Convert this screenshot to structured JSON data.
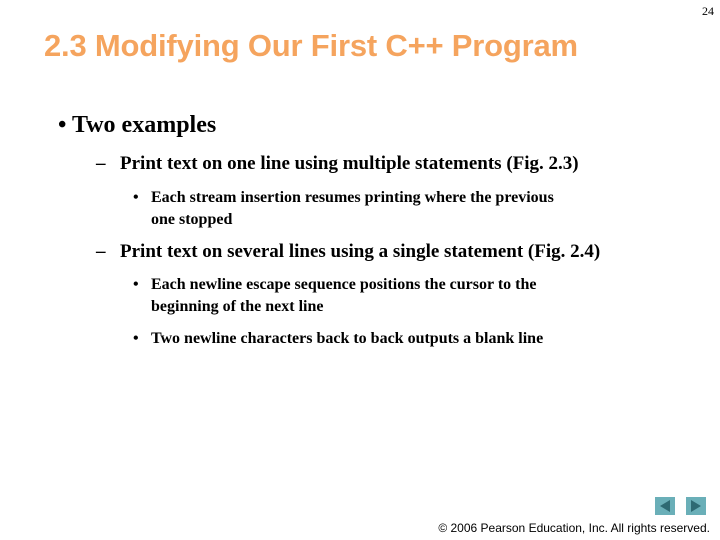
{
  "slide": {
    "page_number": "24",
    "title": "2.3 Modifying Our First C++ Program",
    "bullets": {
      "level1": {
        "marker": "•",
        "text": "Two examples"
      },
      "sub1": {
        "marker": "–",
        "text": "Print text on one line using multiple statements (Fig. 2.3)",
        "items": [
          {
            "marker": "•",
            "line1": "Each stream insertion resumes printing where the previous",
            "line2": "one stopped"
          }
        ]
      },
      "sub2": {
        "marker": "–",
        "text": "Print text on several lines using a single statement (Fig. 2.4)",
        "items": [
          {
            "marker": "•",
            "line1": "Each newline escape sequence positions the cursor to the",
            "line2": "beginning of the next line"
          },
          {
            "marker": "•",
            "line1": "Two newline characters back to back outputs a blank line"
          }
        ]
      }
    }
  },
  "navigation": {
    "previous_icon": "triangle-left-icon",
    "next_icon": "triangle-right-icon",
    "button_color": "#6AAFB8",
    "arrow_color": "#2E6A73"
  },
  "footer": {
    "copyright": "© 2006 Pearson Education, Inc.  All rights reserved."
  },
  "colors": {
    "title": "#F5A45E",
    "text": "#000000",
    "background": "#FFFFFF"
  }
}
